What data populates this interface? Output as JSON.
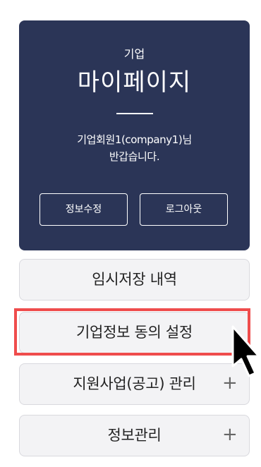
{
  "profile": {
    "kicker": "기업",
    "title": "마이페이지",
    "welcome_line_1": "기업회원1(company1)님",
    "welcome_line_2": "반갑습니다.",
    "edit_button": "정보수정",
    "logout_button": "로그아웃"
  },
  "menu": {
    "items": [
      {
        "label": "임시저장 내역",
        "icon": ""
      },
      {
        "label": "기업정보 동의 설정",
        "icon": ""
      },
      {
        "label": "지원사업(공고) 관리",
        "icon": "+"
      },
      {
        "label": "정보관리",
        "icon": "+"
      }
    ]
  },
  "colors": {
    "card_background": "#2b3557",
    "menu_background": "#f3f3f5",
    "highlight": "#ef4c4c",
    "text": "#222222"
  }
}
